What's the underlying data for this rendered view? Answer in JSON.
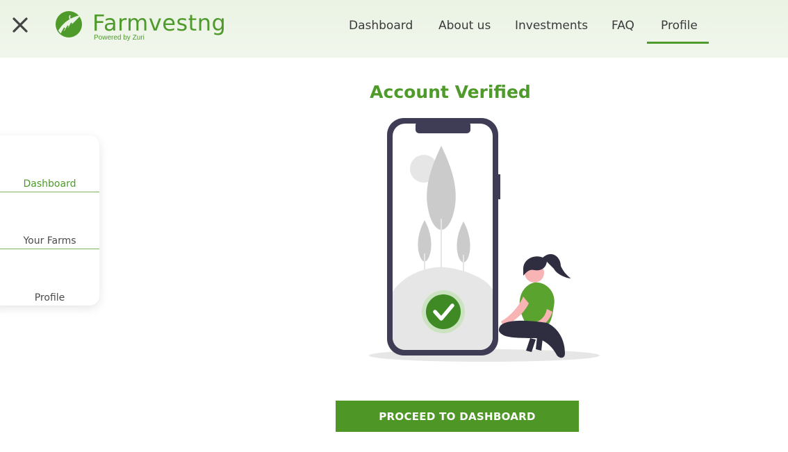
{
  "header": {
    "brand_title": "Farmvestng",
    "brand_subtitle": "Powered by Zuri",
    "nav": [
      {
        "label": "Dashboard"
      },
      {
        "label": "About us"
      },
      {
        "label": "Investments"
      },
      {
        "label": "FAQ"
      },
      {
        "label": "Profile",
        "active": true
      }
    ]
  },
  "sidebar": {
    "items": [
      {
        "label": "Dashboard",
        "active": true
      },
      {
        "label": "Your Farms"
      },
      {
        "label": "Profile"
      }
    ]
  },
  "main": {
    "heading": "Account Verified",
    "proceed_button": "PROCEED TO DASHBOARD"
  },
  "icons": {
    "close": "close-icon",
    "logo": "farmvestng-logo-icon",
    "check": "checkmark-icon"
  },
  "colors": {
    "brand_green": "#4e9a2a",
    "button_green": "#4e9626",
    "header_bg": "#eaf3e4"
  }
}
